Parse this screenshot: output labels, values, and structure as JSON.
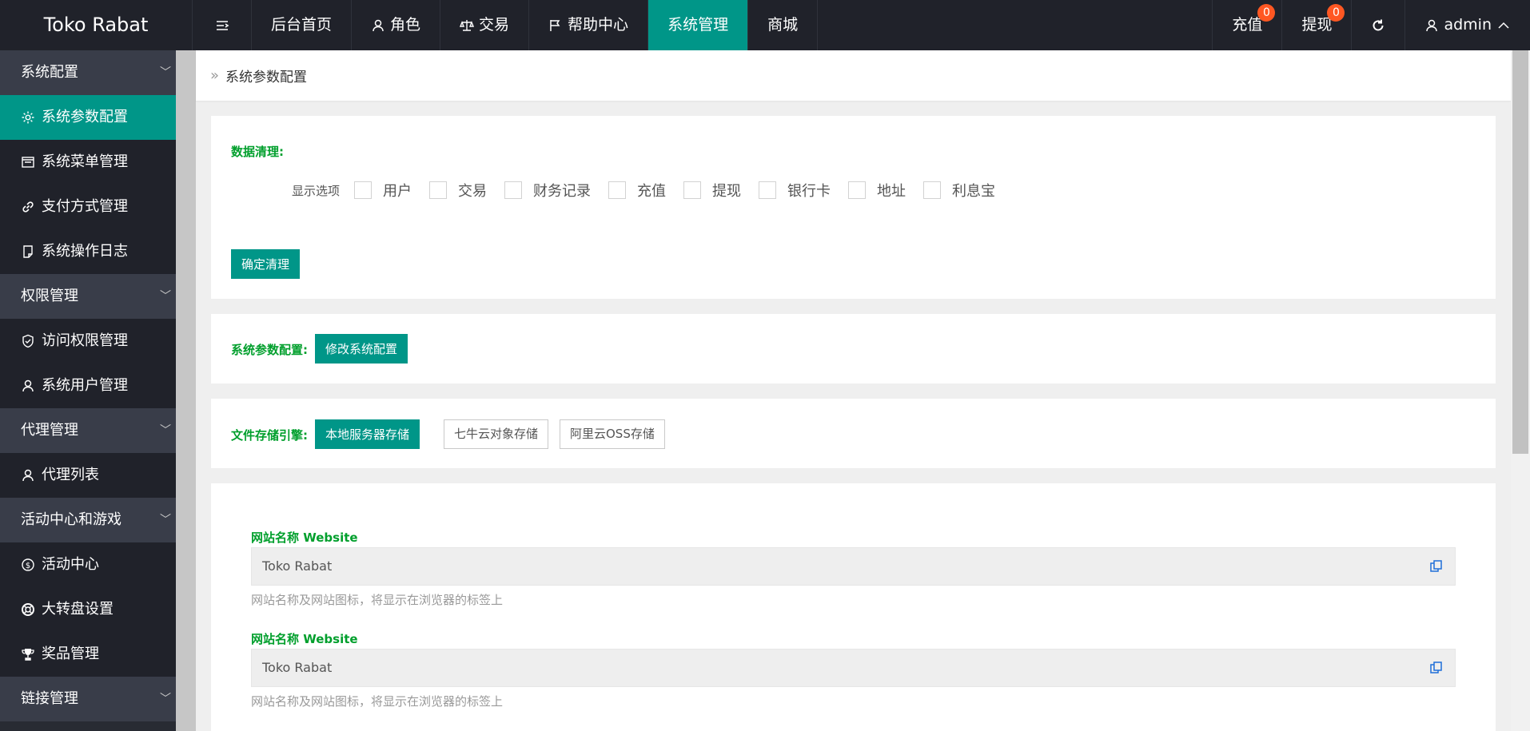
{
  "header": {
    "logo": "Toko Rabat",
    "nav": [
      {
        "label": "后台首页",
        "icon": "home"
      },
      {
        "label": "角色",
        "icon": "user-icon"
      },
      {
        "label": "交易",
        "icon": "scale-icon"
      },
      {
        "label": "帮助中心",
        "icon": "flag-icon"
      },
      {
        "label": "系统管理",
        "active": true
      },
      {
        "label": "商城"
      }
    ],
    "right": {
      "recharge": {
        "label": "充值",
        "count": "0"
      },
      "withdraw": {
        "label": "提现",
        "count": "0"
      },
      "user": "admin"
    }
  },
  "sidebar": {
    "groups": [
      {
        "label": "系统配置",
        "items": [
          "系统参数配置",
          "系统菜单管理",
          "支付方式管理",
          "系统操作日志"
        ]
      },
      {
        "label": "权限管理",
        "items": [
          "访问权限管理",
          "系统用户管理"
        ]
      },
      {
        "label": "代理管理",
        "items": [
          "代理列表"
        ]
      },
      {
        "label": "活动中心和游戏",
        "items": [
          "活动中心",
          "大转盘设置",
          "奖品管理"
        ]
      },
      {
        "label": "链接管理",
        "items": []
      }
    ],
    "active_item": "系统参数配置"
  },
  "breadcrumb": {
    "current": "系统参数配置"
  },
  "clean": {
    "title": "数据清理:",
    "options_label": "显示选项",
    "options": [
      "用户",
      "交易",
      "财务记录",
      "充值",
      "提现",
      "银行卡",
      "地址",
      "利息宝"
    ],
    "confirm_button": "确定清理"
  },
  "config": {
    "title": "系统参数配置:",
    "edit_button": "修改系统配置"
  },
  "storage": {
    "title": "文件存储引擎:",
    "options": [
      "本地服务器存储",
      "七牛云对象存储",
      "阿里云OSS存储"
    ],
    "selected": "本地服务器存储"
  },
  "form": {
    "fields": [
      {
        "label": "网站名称 Website",
        "value": "Toko Rabat",
        "help": "网站名称及网站图标，将显示在浏览器的标签上"
      },
      {
        "label": "网站名称 Website",
        "value": "Toko Rabat",
        "help": "网站名称及网站图标，将显示在浏览器的标签上"
      }
    ]
  },
  "colors": {
    "accent": "#009688",
    "header_bg": "#20222a",
    "label_green": "#009f2c",
    "badge": "#ff5722"
  }
}
